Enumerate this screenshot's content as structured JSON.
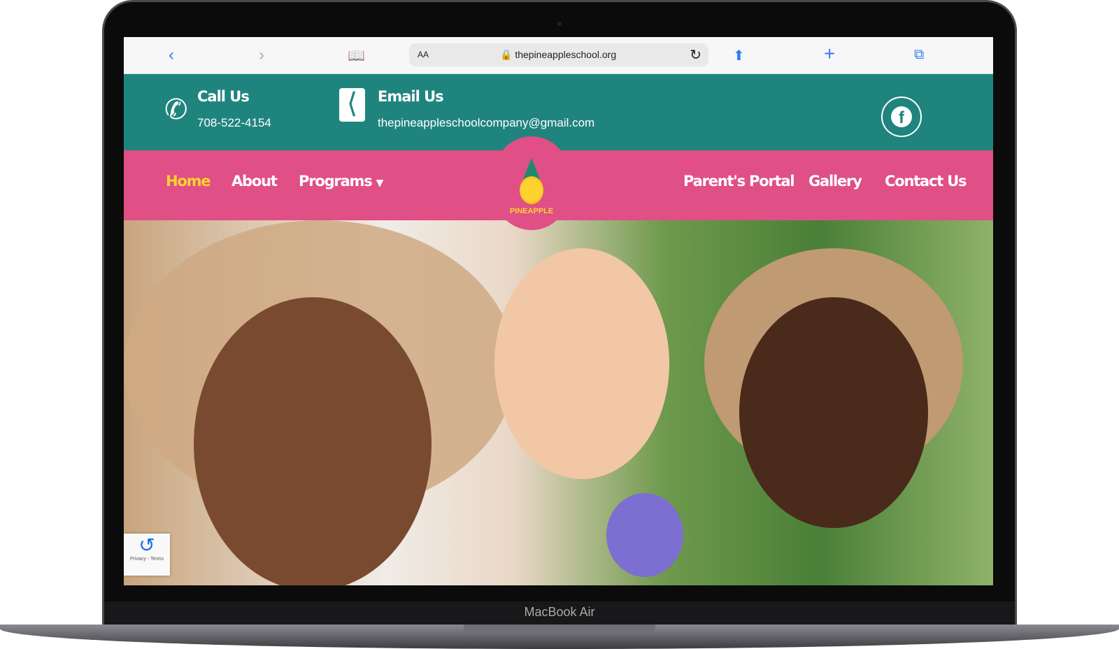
{
  "device": {
    "label": "MacBook Air"
  },
  "browser": {
    "text_size": "AA",
    "url": "thepineappleschool.org",
    "icons": [
      "back-icon",
      "forward-icon",
      "bookmarks-icon",
      "lock-icon",
      "reload-icon",
      "share-icon",
      "new-tab-icon",
      "tabs-icon"
    ]
  },
  "topbar": {
    "call_title": "Call Us",
    "phone": "708-522-4154",
    "email_title": "Email Us",
    "email": "thepineappleschoolcompany@gmail.com",
    "social": "facebook-icon"
  },
  "nav": {
    "items": [
      {
        "label": "Home",
        "active": true
      },
      {
        "label": "About"
      },
      {
        "label": "Programs",
        "dropdown": true
      },
      {
        "label": "Parent's Portal"
      },
      {
        "label": "Gallery"
      },
      {
        "label": "Contact Us"
      }
    ],
    "logo_text": "PINEAPPLE"
  },
  "recaptcha": {
    "label": "Privacy - Terms"
  },
  "colors": {
    "teal": "#20847e",
    "pink": "#e04f85",
    "active": "#ffd230"
  }
}
